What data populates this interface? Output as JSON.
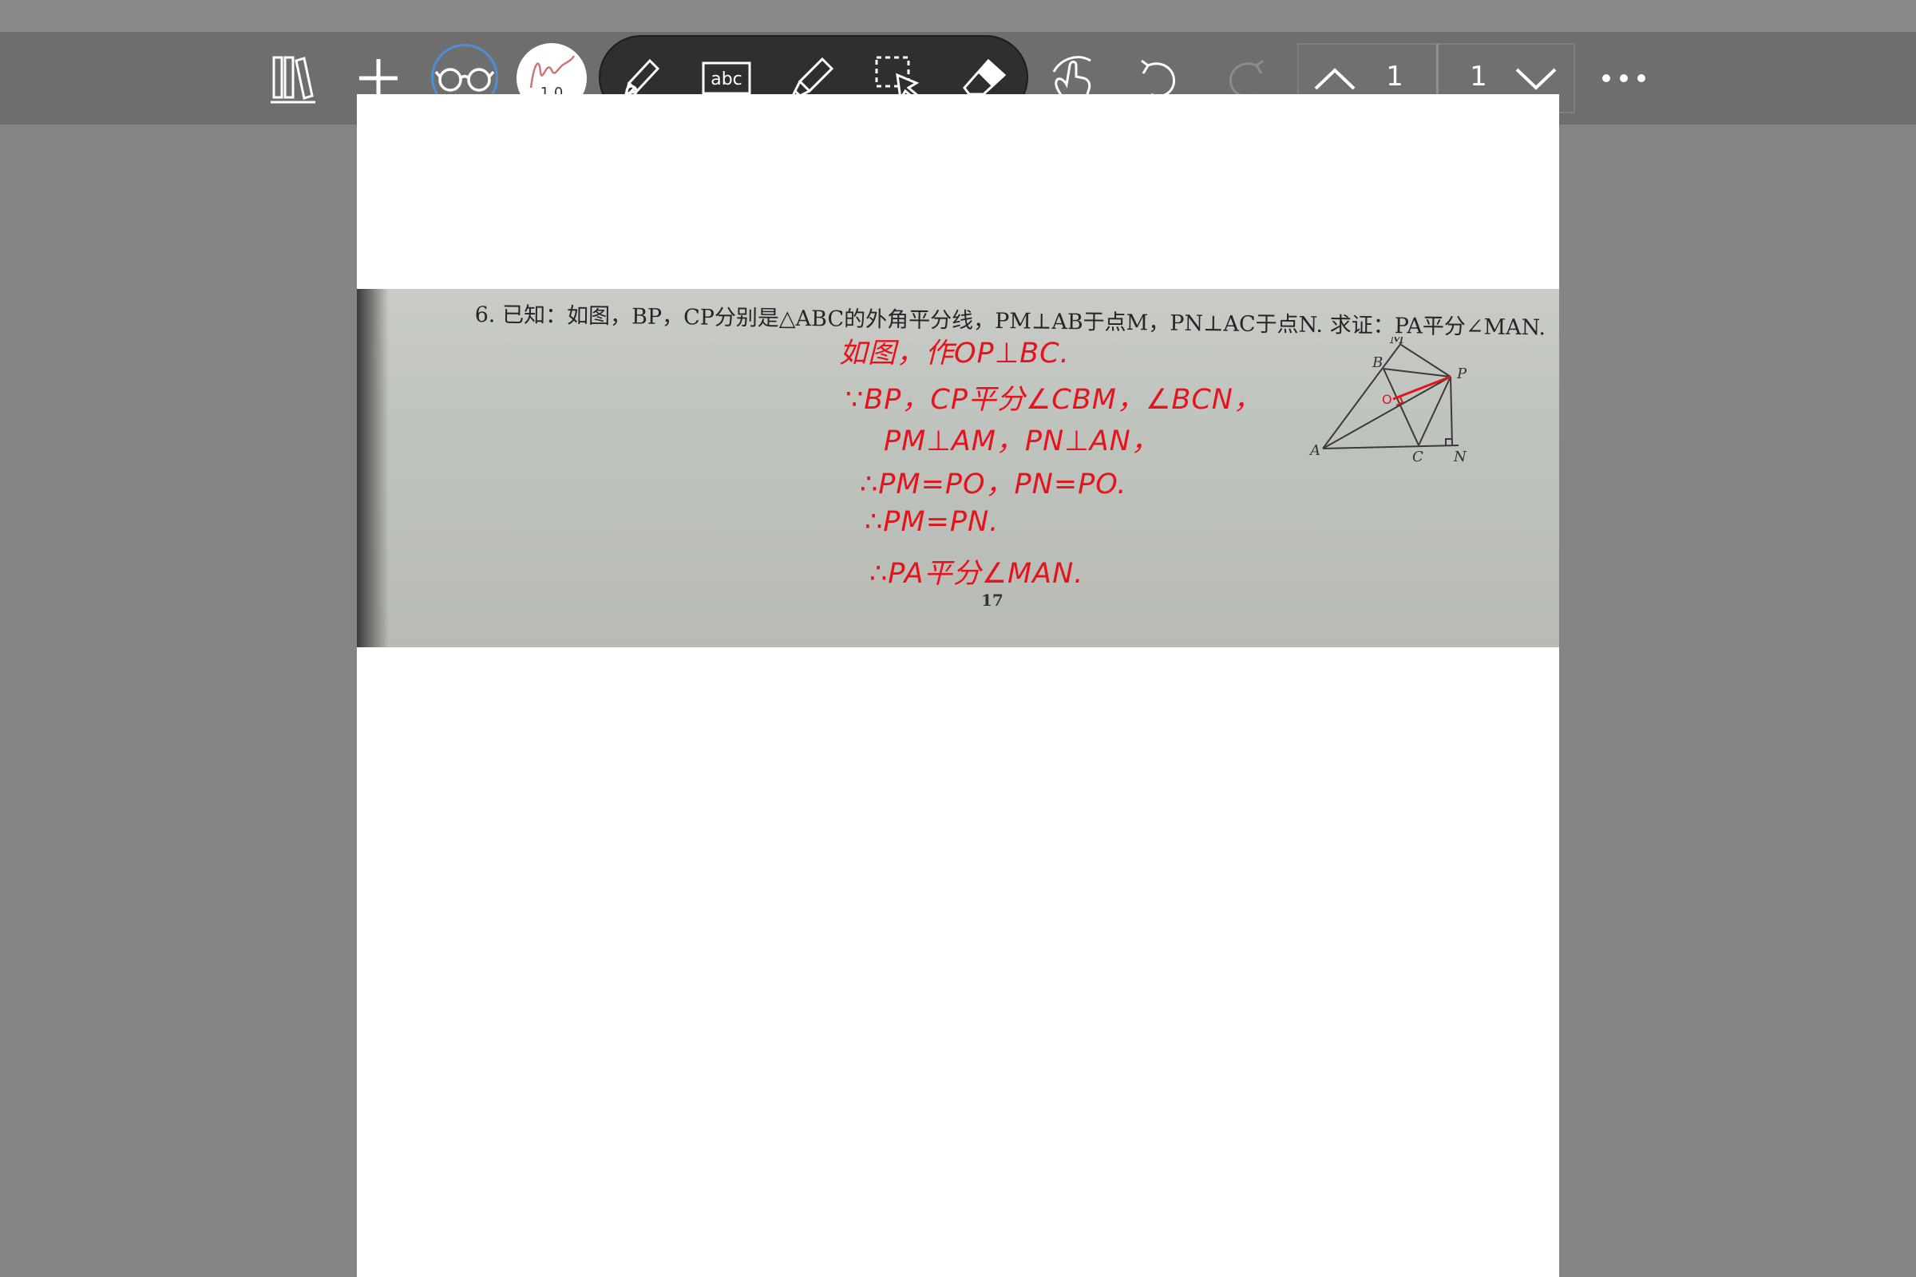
{
  "toolbar": {
    "items": [
      {
        "name": "library",
        "icon": "bookshelf-icon"
      },
      {
        "name": "add",
        "icon": "plus-icon"
      },
      {
        "name": "reading-mode",
        "icon": "glasses-icon",
        "active": true
      },
      {
        "name": "pen-settings",
        "icon": "signature-pen-icon",
        "pen_size": "1.0"
      },
      {
        "name": "pencil",
        "icon": "pencil-icon"
      },
      {
        "name": "text",
        "icon": "text-box-icon",
        "label": "abc"
      },
      {
        "name": "highlighter",
        "icon": "highlighter-icon"
      },
      {
        "name": "lasso-select",
        "icon": "lasso-select-icon"
      },
      {
        "name": "eraser",
        "icon": "eraser-icon"
      },
      {
        "name": "touch-draw",
        "icon": "finger-draw-icon"
      },
      {
        "name": "undo",
        "icon": "undo-icon"
      },
      {
        "name": "redo",
        "icon": "redo-icon",
        "disabled": true
      },
      {
        "name": "more",
        "icon": "more-dots-icon"
      }
    ],
    "pager": {
      "current_page": "1",
      "total_pages": "1"
    },
    "accent_color": "#4c8fd6",
    "group_bg": "#2f2f2f"
  },
  "document": {
    "problem_text": "6. 已知：如图，BP，CP分别是△ABC的外角平分线，PM⊥AB于点M，PN⊥AC于点N. 求证：PA平分∠MAN.",
    "handwriting": [
      "如图，作OP⊥BC.",
      "∵BP，CP平分∠CBM，∠BCN，",
      "PM⊥AM，PN⊥AN，",
      "∴PM=PO，PN=PO.",
      "∴PM=PN.",
      "∴PA平分∠MAN."
    ],
    "handwriting_color": "#e8121d",
    "page_number": "17",
    "diagram_labels": {
      "A": "A",
      "B": "B",
      "C": "C",
      "M": "M",
      "N": "N",
      "P": "P",
      "O": "O"
    }
  }
}
